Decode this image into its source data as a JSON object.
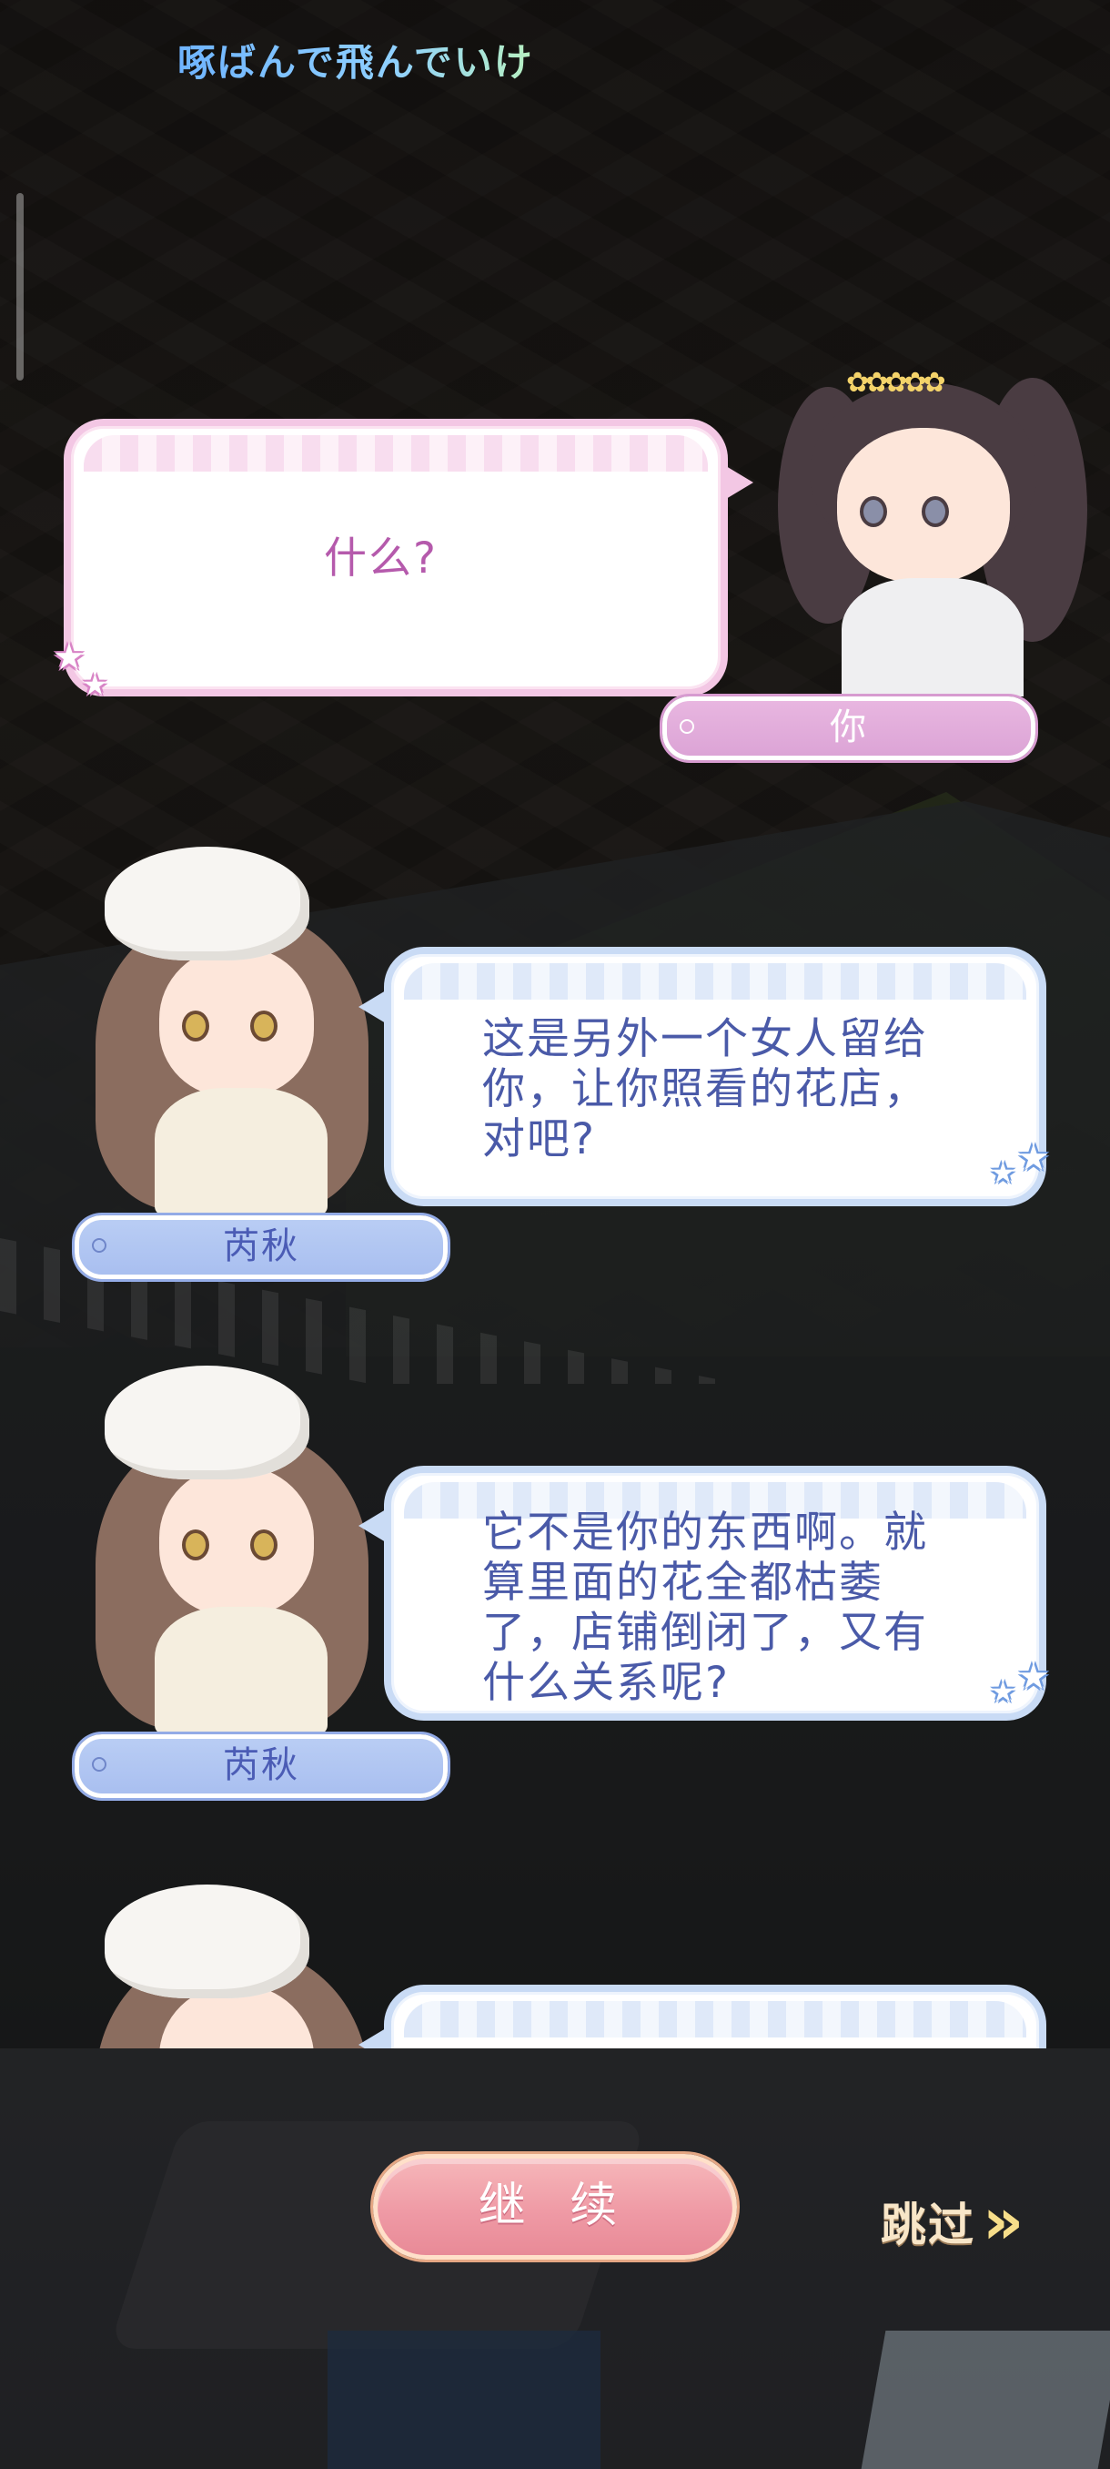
{
  "header": {
    "song_title": "啄ばんで飛んでいけ"
  },
  "dialogue": [
    {
      "speaker": "你",
      "text": "什么?",
      "side": "player"
    },
    {
      "speaker": "芮秋",
      "text_lines": [
        "这是另外一个女人留给",
        "你，让你照看的花店，",
        "对吧?"
      ],
      "side": "npc"
    },
    {
      "speaker": "芮秋",
      "text_lines": [
        "它不是你的东西啊。就",
        "算里面的花全都枯萎",
        "了，店铺倒闭了，又有",
        "什么关系呢?"
      ],
      "side": "npc"
    },
    {
      "speaker": "芮秋",
      "text_lines": [],
      "side": "npc"
    }
  ],
  "controls": {
    "continue_label": "继 续",
    "skip_label": "跳过"
  },
  "icons": {
    "skip": "double-chevron-right-icon",
    "star": "star-icon"
  },
  "colors": {
    "player_bubble_border": "#f3c7e4",
    "player_text": "#b55aac",
    "npc_bubble_border": "#c9dbf5",
    "npc_text": "#4a5aa8",
    "continue_button": "#ef9aa5",
    "skip_text": "#f8e6c8"
  }
}
